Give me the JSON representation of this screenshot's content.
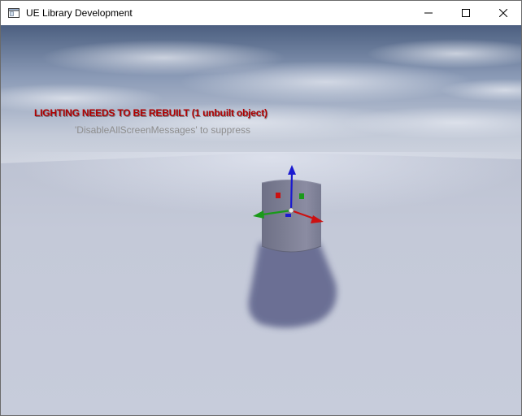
{
  "window": {
    "title": "UE Library Development",
    "icon": "app-window-icon"
  },
  "controls": {
    "minimize_icon": "minimize-icon",
    "maximize_icon": "maximize-icon",
    "close_icon": "close-icon"
  },
  "viewport": {
    "warning_text": "LIGHTING NEEDS TO BE REBUILT (1 unbuilt object)",
    "hint_text": "'DisableAllScreenMessages' to suppress"
  },
  "colors": {
    "warning": "#b00000",
    "hint": "#8e8e8e",
    "gizmo_x": "#cc1111",
    "gizmo_y": "#1a9a1a",
    "gizmo_z": "#1a1ad0"
  }
}
